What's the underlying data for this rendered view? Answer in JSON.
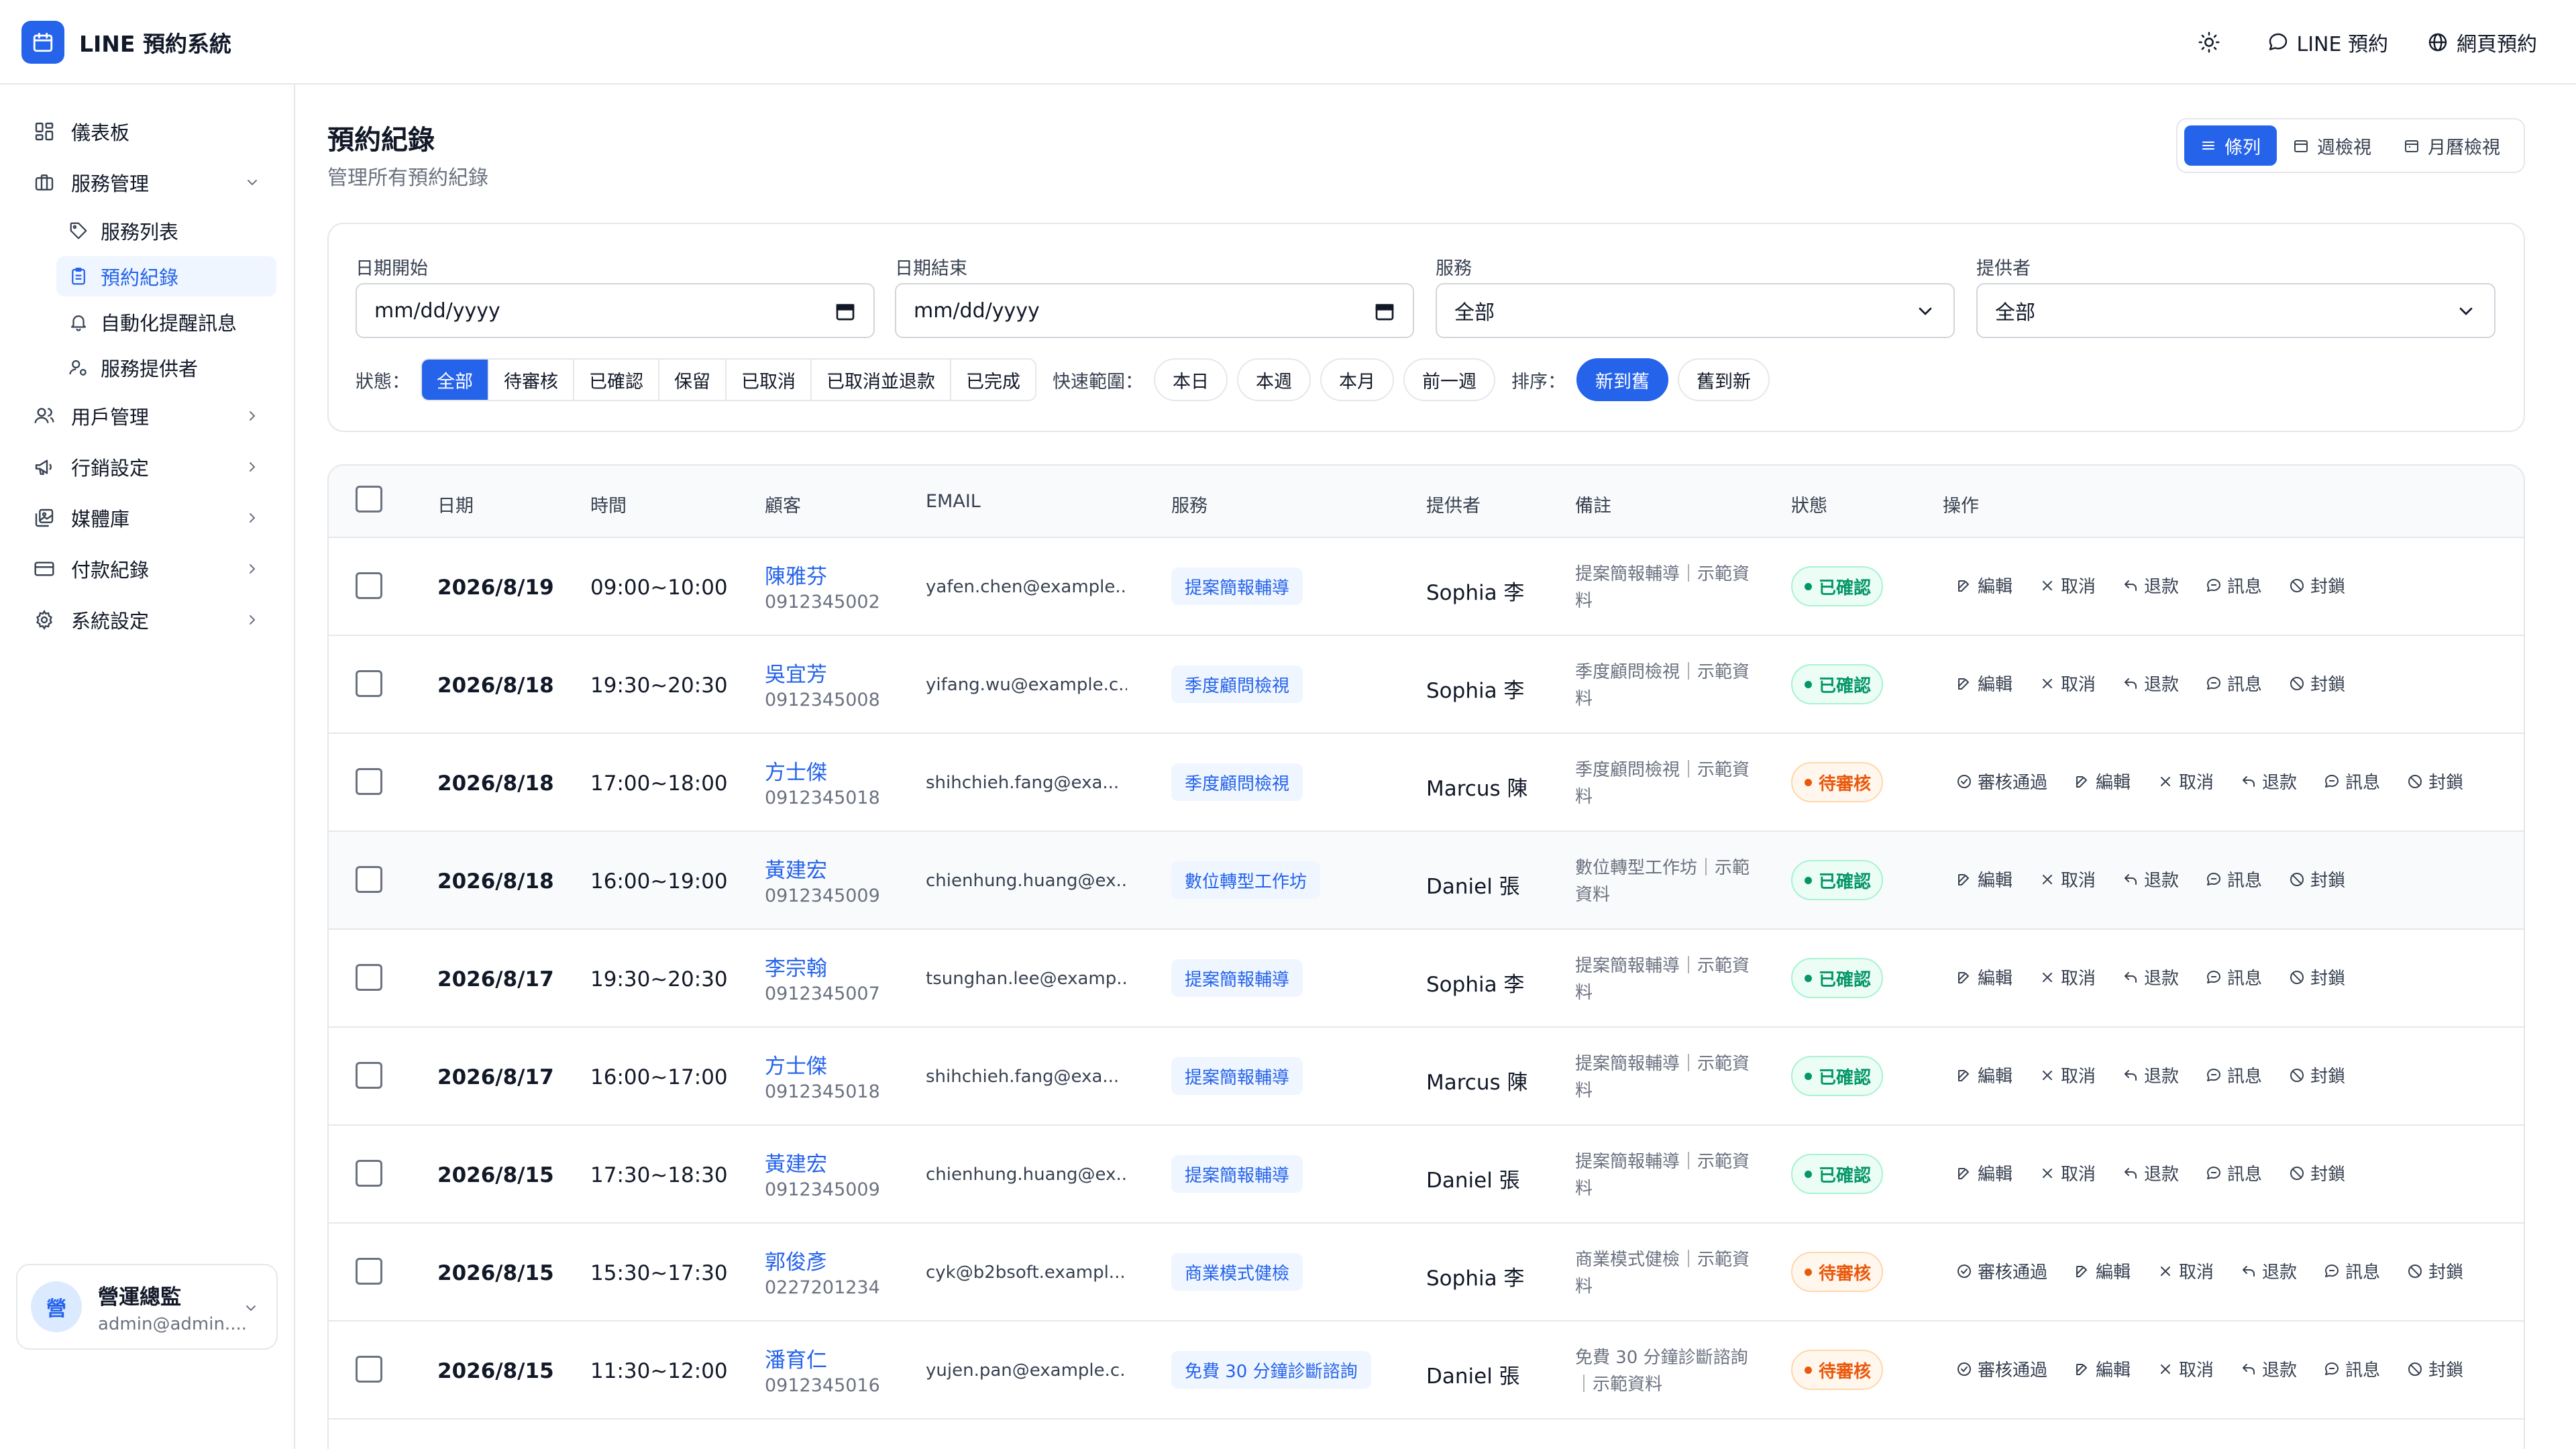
{
  "app": {
    "title": "LINE 預約系統"
  },
  "header": {
    "line_booking": "LINE 預約",
    "web_booking": "網頁預約"
  },
  "sidebar": {
    "dashboard": "儀表板",
    "service_mgmt": "服務管理",
    "service_list": "服務列表",
    "booking_records": "預約紀錄",
    "auto_reminder": "自動化提醒訊息",
    "providers": "服務提供者",
    "user_mgmt": "用戶管理",
    "marketing": "行銷設定",
    "media": "媒體庫",
    "payments": "付款紀錄",
    "settings": "系統設定"
  },
  "user": {
    "avatar": "營",
    "name": "營運總監",
    "email": "admin@admin...."
  },
  "page": {
    "title": "預約紀錄",
    "subtitle": "管理所有預約紀錄"
  },
  "view_toggle": {
    "list": "條列",
    "week": "週檢視",
    "month": "月曆檢視"
  },
  "filters": {
    "date_start_label": "日期開始",
    "date_start_value": "mm/dd/yyyy",
    "date_end_label": "日期結束",
    "date_end_value": "mm/dd/yyyy",
    "service_label": "服務",
    "service_value": "全部",
    "provider_label": "提供者",
    "provider_value": "全部",
    "status_label": "狀態：",
    "status_options": [
      "全部",
      "待審核",
      "已確認",
      "保留",
      "已取消",
      "已取消並退款",
      "已完成"
    ],
    "range_label": "快速範圍：",
    "range_options": [
      "本日",
      "本週",
      "本月",
      "前一週"
    ],
    "sort_label": "排序：",
    "sort_options": [
      "新到舊",
      "舊到新"
    ]
  },
  "table": {
    "headers": {
      "date": "日期",
      "time": "時間",
      "customer": "顧客",
      "email": "EMAIL",
      "service": "服務",
      "provider": "提供者",
      "note": "備註",
      "status": "狀態",
      "actions": "操作"
    },
    "actions": {
      "approve": "審核通過",
      "edit": "編輯",
      "cancel": "取消",
      "refund": "退款",
      "message": "訊息",
      "block": "封鎖"
    },
    "rows": [
      {
        "date": "2026/8/19",
        "time": "09:00~10:00",
        "name": "陳雅芬",
        "phone": "0912345002",
        "email": "yafen.chen@example...",
        "service": "提案簡報輔導",
        "provider": "Sophia 李",
        "note": "提案簡報輔導｜示範資料",
        "status": "已確認",
        "status_type": "confirmed"
      },
      {
        "date": "2026/8/18",
        "time": "19:30~20:30",
        "name": "吳宜芳",
        "phone": "0912345008",
        "email": "yifang.wu@example.c...",
        "service": "季度顧問檢視",
        "provider": "Sophia 李",
        "note": "季度顧問檢視｜示範資料",
        "status": "已確認",
        "status_type": "confirmed"
      },
      {
        "date": "2026/8/18",
        "time": "17:00~18:00",
        "name": "方士傑",
        "phone": "0912345018",
        "email": "shihchieh.fang@exa...",
        "service": "季度顧問檢視",
        "provider": "Marcus 陳",
        "note": "季度顧問檢視｜示範資料",
        "status": "待審核",
        "status_type": "pending"
      },
      {
        "date": "2026/8/18",
        "time": "16:00~19:00",
        "name": "黃建宏",
        "phone": "0912345009",
        "email": "chienhung.huang@ex...",
        "service": "數位轉型工作坊",
        "provider": "Daniel 張",
        "note": "數位轉型工作坊｜示範資料",
        "status": "已確認",
        "status_type": "confirmed"
      },
      {
        "date": "2026/8/17",
        "time": "19:30~20:30",
        "name": "李宗翰",
        "phone": "0912345007",
        "email": "tsunghan.lee@examp...",
        "service": "提案簡報輔導",
        "provider": "Sophia 李",
        "note": "提案簡報輔導｜示範資料",
        "status": "已確認",
        "status_type": "confirmed"
      },
      {
        "date": "2026/8/17",
        "time": "16:00~17:00",
        "name": "方士傑",
        "phone": "0912345018",
        "email": "shihchieh.fang@exa...",
        "service": "提案簡報輔導",
        "provider": "Marcus 陳",
        "note": "提案簡報輔導｜示範資料",
        "status": "已確認",
        "status_type": "confirmed"
      },
      {
        "date": "2026/8/15",
        "time": "17:30~18:30",
        "name": "黃建宏",
        "phone": "0912345009",
        "email": "chienhung.huang@ex...",
        "service": "提案簡報輔導",
        "provider": "Daniel 張",
        "note": "提案簡報輔導｜示範資料",
        "status": "已確認",
        "status_type": "confirmed"
      },
      {
        "date": "2026/8/15",
        "time": "15:30~17:30",
        "name": "郭俊彥",
        "phone": "0227201234",
        "email": "cyk@b2bsoft.exampl...",
        "service": "商業模式健檢",
        "provider": "Sophia 李",
        "note": "商業模式健檢｜示範資料",
        "status": "待審核",
        "status_type": "pending"
      },
      {
        "date": "2026/8/15",
        "time": "11:30~12:00",
        "name": "潘育仁",
        "phone": "0912345016",
        "email": "yujen.pan@example.c...",
        "service": "免費 30 分鐘診斷諮詢",
        "provider": "Daniel 張",
        "note": "免費 30 分鐘診斷諮詢｜示範資料",
        "status": "待審核",
        "status_type": "pending"
      }
    ]
  },
  "colors": {
    "accent": "#2563eb",
    "confirmed": "#059669",
    "pending": "#ea580c"
  }
}
